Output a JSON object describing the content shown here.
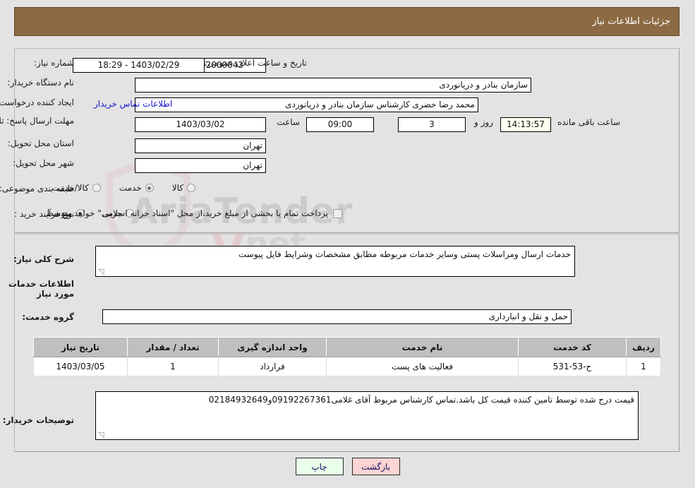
{
  "header": {
    "title": "جزئیات اطلاعات نیاز"
  },
  "need_info": {
    "need_number_label": "شماره نیاز:",
    "need_number_value": "1103003292000043",
    "announce_datetime_label": "تاریخ و ساعت اعلان عمومی:",
    "announce_datetime_value": "18:29 - 1403/02/29",
    "buyer_org_label": "نام دستگاه خریدار:",
    "buyer_org_value": "سازمان بنادر و دریانوردی",
    "creator_label": "ایجاد کننده درخواست:",
    "creator_value": "محمد رضا خضری کارشناس سازمان بنادر و دریانوردی",
    "contact_link": "اطلاعات تماس خریدار",
    "deadline_label": "مهلت ارسال پاسخ: تا تاریخ:",
    "deadline_date": "1403/03/02",
    "deadline_time_label": "ساعت",
    "deadline_time": "09:00",
    "remaining_days": "3",
    "remaining_days_label": "روز و",
    "remaining_time": "14:13:57",
    "remaining_suffix_label": "ساعت باقی مانده",
    "province_label": "استان محل تحویل:",
    "province_value": "تهران",
    "city_label": "شهر محل تحویل:",
    "city_value": "تهران",
    "category_label": "طبقه بندی موضوعی:",
    "category_options": [
      {
        "label": "کالا",
        "selected": false
      },
      {
        "label": "خدمت",
        "selected": true
      },
      {
        "label": "کالا/خدمت",
        "selected": false
      }
    ],
    "purchase_type_label": "نوع فرآیند خرید :",
    "purchase_type_options": [
      {
        "label": "جزیی",
        "selected": false
      },
      {
        "label": "متوسط",
        "selected": true
      }
    ],
    "treasury_checkbox_label": "پرداخت تمام یا بخشی از مبلغ خرید،از محل \"اسناد خزانه اسلامی\" خواهد بود.",
    "treasury_checked": false
  },
  "description": {
    "general_label": "شرح کلی نیاز:",
    "general_value": "خدمات ارسال ومراسلات پستی وسایر خدمات مربوطه مطابق مشخصات وشرایط فایل پیوست",
    "services_heading": "اطلاعات خدمات مورد نیاز",
    "service_group_label": "گروه خدمت:",
    "service_group_value": "حمل و نقل و انبارداری"
  },
  "table": {
    "columns": [
      "ردیف",
      "کد خدمت",
      "نام خدمت",
      "واحد اندازه گیری",
      "تعداد / مقدار",
      "تاریخ نیاز"
    ],
    "rows": [
      {
        "row": "1",
        "service_code": "ح-53-531",
        "service_name": "فعالیت های پست",
        "unit": "قرارداد",
        "quantity": "1",
        "need_date": "1403/03/05"
      }
    ]
  },
  "buyer_notes": {
    "label": "توضیحات خریدار:",
    "value": "قیمت درج شده توسط تامین کننده قیمت کل باشد.تماس کارشناس مربوط آقای غلامی09192267361و02184932649"
  },
  "footer": {
    "back_label": "بازگشت",
    "print_label": "چاپ"
  },
  "watermark": {
    "text": "AriaTender",
    "text2": ".net"
  },
  "colors": {
    "header_bg": "#8c6a43",
    "link": "#1414cf",
    "back_btn": "#ffd4d4",
    "print_btn": "#eaffea",
    "timer_bg": "#fffff0",
    "table_header": "#bfbfbf"
  }
}
